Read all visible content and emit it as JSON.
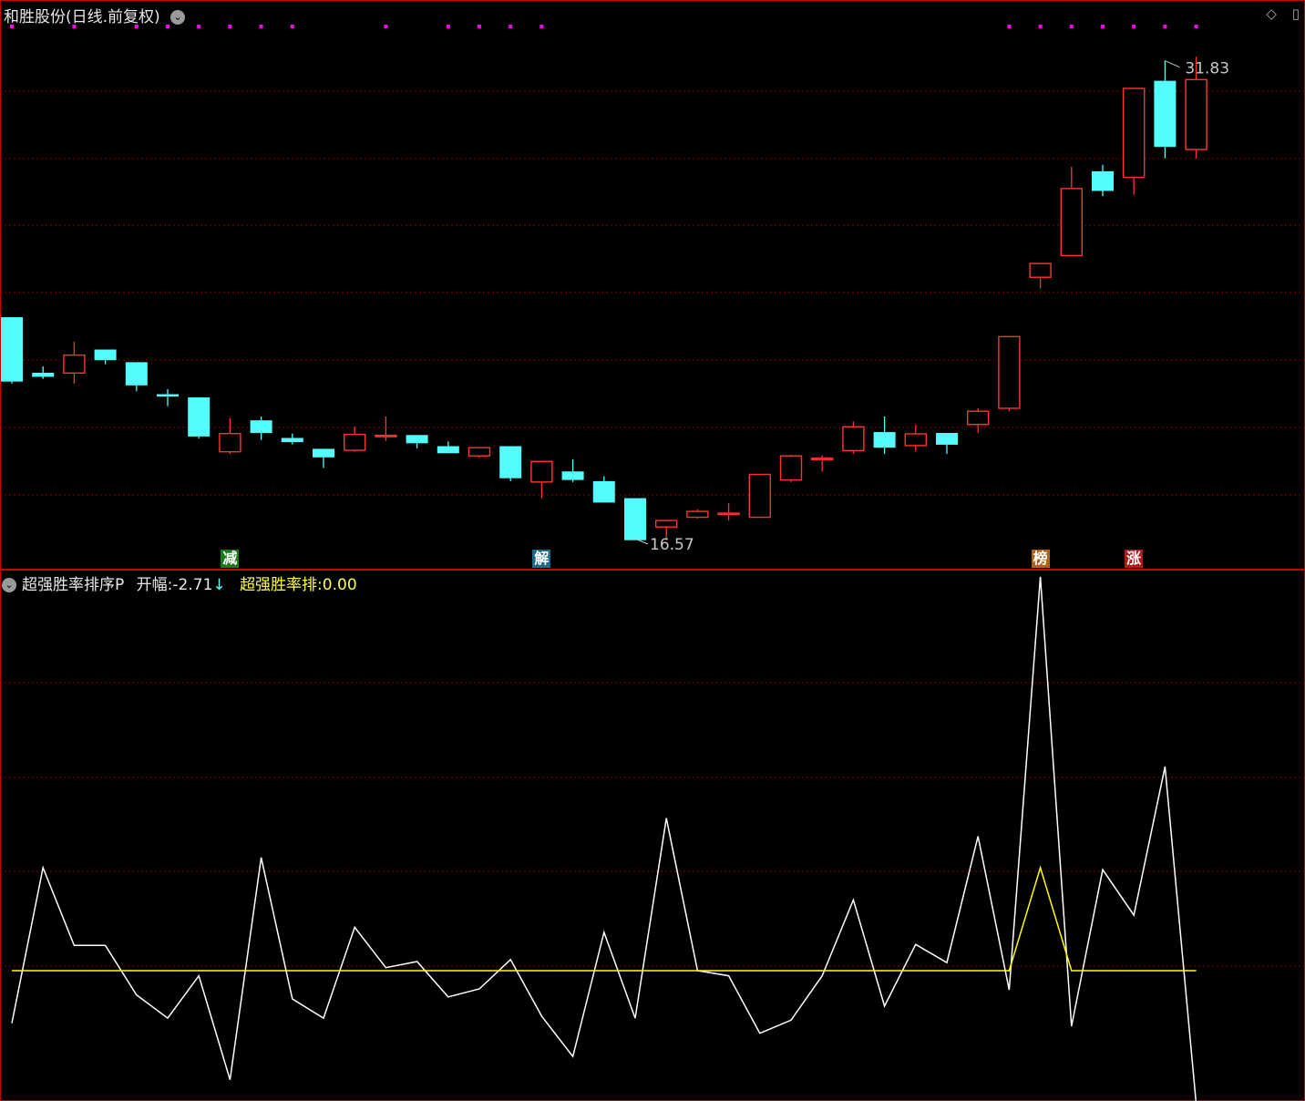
{
  "window": {
    "title": "和胜股份(日线.前复权)",
    "expand_icon": "chevron-down-icon",
    "controls": [
      "◇",
      "▯"
    ]
  },
  "indicator": {
    "name": "超强胜率排序P",
    "label_open": "开幅:",
    "value_open": "-2.71",
    "arrow": "↓",
    "label_rank": "超强胜率排:",
    "value_rank": "0.00"
  },
  "colors": {
    "up": "#ff3232",
    "down": "#54fcfc",
    "grid": "#8a0000",
    "line_white": "#ffffff",
    "line_yellow": "#ffff00",
    "marker": "#ff00ff",
    "annotation": "#c8c8c8"
  },
  "chart_data": [
    {
      "type": "candlestick",
      "title": "和胜股份(日线.前复权)",
      "ylim": [
        14.6,
        33.9
      ],
      "grid": true,
      "candles": [
        {
          "o": 23.1,
          "c": 20.91,
          "h": 23.1,
          "l": 20.84
        },
        {
          "o": 21.21,
          "c": 21.07,
          "h": 21.43,
          "l": 21.0
        },
        {
          "o": 21.2,
          "c": 21.81,
          "h": 22.27,
          "l": 20.84
        },
        {
          "o": 22.0,
          "c": 21.64,
          "h": 22.0,
          "l": 21.5
        },
        {
          "o": 21.57,
          "c": 20.78,
          "h": 21.57,
          "l": 20.58
        },
        {
          "o": 20.48,
          "c": 20.4,
          "h": 20.65,
          "l": 20.07
        },
        {
          "o": 20.37,
          "c": 19.04,
          "h": 20.37,
          "l": 18.97
        },
        {
          "o": 18.52,
          "c": 19.14,
          "h": 19.67,
          "l": 18.44
        },
        {
          "o": 19.59,
          "c": 19.16,
          "h": 19.72,
          "l": 18.92
        },
        {
          "o": 18.99,
          "c": 18.85,
          "h": 19.14,
          "l": 18.77
        },
        {
          "o": 18.62,
          "c": 18.33,
          "h": 18.62,
          "l": 17.97
        },
        {
          "o": 18.57,
          "c": 19.11,
          "h": 19.38,
          "l": 18.52
        },
        {
          "o": 19.08,
          "c": 19.08,
          "h": 19.72,
          "l": 18.89
        },
        {
          "o": 19.09,
          "c": 18.81,
          "h": 19.09,
          "l": 18.64
        },
        {
          "o": 18.71,
          "c": 18.47,
          "h": 18.87,
          "l": 18.47
        },
        {
          "o": 18.38,
          "c": 18.66,
          "h": 18.66,
          "l": 18.31
        },
        {
          "o": 18.71,
          "c": 17.62,
          "h": 18.71,
          "l": 17.52
        },
        {
          "o": 17.49,
          "c": 18.19,
          "h": 18.19,
          "l": 16.94
        },
        {
          "o": 17.85,
          "c": 17.56,
          "h": 18.26,
          "l": 17.49
        },
        {
          "o": 17.52,
          "c": 16.79,
          "h": 17.69,
          "l": 16.79
        },
        {
          "o": 16.94,
          "c": 15.51,
          "h": 16.94,
          "l": 15.51
        },
        {
          "o": 15.96,
          "c": 16.18,
          "h": 16.18,
          "l": 15.51
        },
        {
          "o": 16.29,
          "c": 16.49,
          "h": 16.56,
          "l": 16.25
        },
        {
          "o": 16.43,
          "c": 16.43,
          "h": 16.77,
          "l": 16.18
        },
        {
          "o": 16.29,
          "c": 17.75,
          "h": 17.75,
          "l": 16.29
        },
        {
          "o": 17.56,
          "c": 18.38,
          "h": 18.42,
          "l": 17.49
        },
        {
          "o": 18.3,
          "c": 18.3,
          "h": 18.39,
          "l": 17.85
        },
        {
          "o": 18.56,
          "c": 19.37,
          "h": 19.55,
          "l": 18.45
        },
        {
          "o": 19.19,
          "c": 18.66,
          "h": 19.72,
          "l": 18.45
        },
        {
          "o": 18.73,
          "c": 19.13,
          "h": 19.45,
          "l": 18.52
        },
        {
          "o": 19.16,
          "c": 18.76,
          "h": 19.16,
          "l": 18.45
        },
        {
          "o": 19.45,
          "c": 19.9,
          "h": 20.0,
          "l": 19.16
        },
        {
          "o": 20.0,
          "c": 22.44,
          "h": 22.44,
          "l": 19.9
        },
        {
          "o": 24.46,
          "c": 24.93,
          "h": 24.93,
          "l": 24.08
        },
        {
          "o": 25.2,
          "c": 27.48,
          "h": 28.22,
          "l": 25.2
        },
        {
          "o": 28.07,
          "c": 27.4,
          "h": 28.29,
          "l": 27.22
        },
        {
          "o": 27.86,
          "c": 30.89,
          "h": 30.89,
          "l": 27.27
        },
        {
          "o": 31.15,
          "c": 28.9,
          "h": 31.83,
          "l": 28.51
        },
        {
          "o": 28.81,
          "c": 31.19,
          "h": 31.97,
          "l": 28.5
        }
      ],
      "max_label": "31.83",
      "min_label": "16.57",
      "top_markers": [
        0,
        2,
        4,
        5,
        6,
        7,
        8,
        9,
        12,
        14,
        15,
        16,
        17,
        32,
        33,
        34,
        35,
        36,
        37,
        38
      ],
      "signals": [
        {
          "index": 7,
          "label": "减",
          "color": "#1a7a1a"
        },
        {
          "index": 17,
          "label": "解",
          "color": "#1a6a8a"
        },
        {
          "index": 33,
          "label": "榜",
          "color": "#b0621a"
        },
        {
          "index": 36,
          "label": "涨",
          "color": "#b01a1a"
        }
      ]
    },
    {
      "type": "line",
      "title": "超强胜率排序P",
      "ylim": [
        -1.2,
        3.7
      ],
      "grid": true,
      "series": [
        {
          "name": "开幅",
          "color": "#ffffff",
          "values": [
            -0.52,
            1.02,
            0.25,
            0.25,
            -0.24,
            -0.47,
            -0.05,
            -1.08,
            1.12,
            -0.28,
            -0.47,
            0.43,
            0.03,
            0.09,
            -0.26,
            -0.18,
            0.11,
            -0.45,
            -0.85,
            0.38,
            -0.47,
            1.51,
            0.0,
            -0.05,
            -0.62,
            -0.49,
            -0.05,
            0.7,
            -0.35,
            0.26,
            0.08,
            1.33,
            -0.19,
            3.9,
            -0.55,
            1.0,
            0.55,
            2.02,
            -1.32
          ]
        },
        {
          "name": "超强胜率排",
          "color": "#ffff00",
          "values": [
            0,
            0,
            0,
            0,
            0,
            0,
            0,
            0,
            0,
            0,
            0,
            0,
            0,
            0,
            0,
            0,
            0,
            0,
            0,
            0,
            0,
            0,
            0,
            0,
            0,
            0,
            0,
            0,
            0,
            0,
            0,
            0,
            0,
            1.02,
            0,
            0,
            0,
            0,
            0
          ]
        }
      ]
    }
  ]
}
